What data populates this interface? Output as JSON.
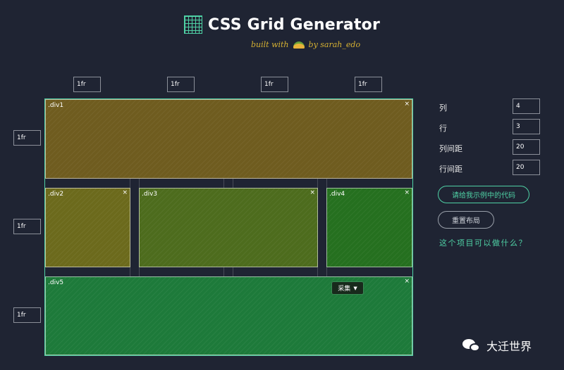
{
  "header": {
    "title": "CSS Grid Generator",
    "subtitle_prefix": "built with",
    "subtitle_suffix": "by sarah_edo"
  },
  "columns": {
    "units": [
      "1fr",
      "1fr",
      "1fr",
      "1fr"
    ]
  },
  "rows": {
    "units": [
      "1fr",
      "1fr",
      "1fr"
    ]
  },
  "grid_items": [
    {
      "label": ".div1",
      "close": "×",
      "color": "#6f5c1f"
    },
    {
      "label": ".div2",
      "close": "×",
      "color": "#6c6a1c"
    },
    {
      "label": ".div3",
      "close": "×",
      "color": "#4d6c1d"
    },
    {
      "label": ".div4",
      "close": "×",
      "color": "#25701f"
    },
    {
      "label": ".div5",
      "close": "×",
      "color": "#1d7a3a"
    }
  ],
  "collect_button": {
    "label": "采集",
    "caret": "▼"
  },
  "settings": {
    "columns_label": "列",
    "columns_value": "4",
    "rows_label": "行",
    "rows_value": "3",
    "col_gap_label": "列间距",
    "col_gap_value": "20",
    "row_gap_label": "行间距",
    "row_gap_value": "20"
  },
  "actions": {
    "show_code": "请给我示例中的代码",
    "reset": "重置布局",
    "what_can_do": "这个项目可以做什么？"
  },
  "watermark": {
    "text": "大迁世界"
  },
  "colors": {
    "background": "#1f2433",
    "accent": "#4fd1a5",
    "subtitle": "#d7b233"
  }
}
